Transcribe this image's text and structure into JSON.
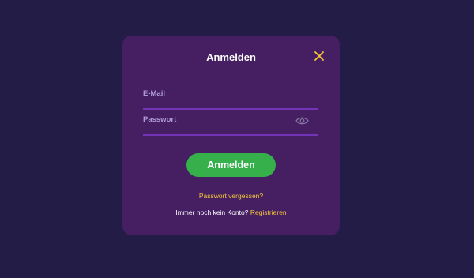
{
  "dialog": {
    "title": "Anmelden",
    "close_icon": "close-icon"
  },
  "form": {
    "email_label": "E-Mail",
    "email_value": "",
    "password_label": "Passwort",
    "password_value": "",
    "show_password_icon": "eye-icon",
    "submit_label": "Anmelden"
  },
  "links": {
    "forgot_password": "Passwort vergessen?",
    "no_account_text": "Immer noch kein Konto?",
    "register": "Registrieren"
  },
  "colors": {
    "background": "#231c47",
    "modal": "#461f63",
    "underline": "#7434b7",
    "label": "#b09ad8",
    "accent": "#f5c838",
    "button": "#35b04a"
  }
}
